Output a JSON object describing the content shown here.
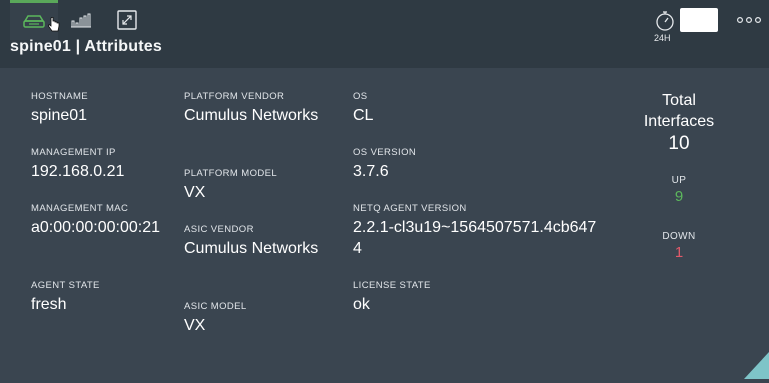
{
  "header": {
    "title": "spine01 | Attributes",
    "tabs": [
      {
        "icon": "switch-icon",
        "active": true
      },
      {
        "icon": "bar-chart-icon",
        "active": false
      },
      {
        "icon": "expand-icon",
        "active": false
      }
    ],
    "time_range_label": "24H",
    "time_icon": "stopwatch-icon",
    "more_icon": "more-dots-icon"
  },
  "attributes": {
    "hostname": {
      "label": "HOSTNAME",
      "value": "spine01"
    },
    "management_ip": {
      "label": "MANAGEMENT IP",
      "value": "192.168.0.21"
    },
    "management_mac": {
      "label": "MANAGEMENT MAC",
      "value": "a0:00:00:00:00:21"
    },
    "agent_state": {
      "label": "AGENT STATE",
      "value": "fresh"
    },
    "platform_vendor": {
      "label": "PLATFORM VENDOR",
      "value": "Cumulus Networks"
    },
    "platform_model": {
      "label": "PLATFORM MODEL",
      "value": "VX"
    },
    "asic_vendor": {
      "label": "ASIC VENDOR",
      "value": "Cumulus Networks"
    },
    "asic_model": {
      "label": "ASIC MODEL",
      "value": "VX"
    },
    "os": {
      "label": "OS",
      "value": "CL"
    },
    "os_version": {
      "label": "OS VERSION",
      "value": "3.7.6"
    },
    "netq_agent_version": {
      "label": "NETQ AGENT VERSION",
      "value": "2.2.1-cl3u19~1564507571.4cb6474"
    },
    "license_state": {
      "label": "LICENSE STATE",
      "value": "ok"
    }
  },
  "interfaces": {
    "title": "Total Interfaces",
    "total": "10",
    "up_label": "UP",
    "up_value": "9",
    "down_label": "DOWN",
    "down_value": "1"
  },
  "colors": {
    "background": "#3a4550",
    "header": "#2f3a43",
    "accent_green": "#5cb85c",
    "down_red": "#e05a6a",
    "resize_handle": "#7ec4c8"
  }
}
